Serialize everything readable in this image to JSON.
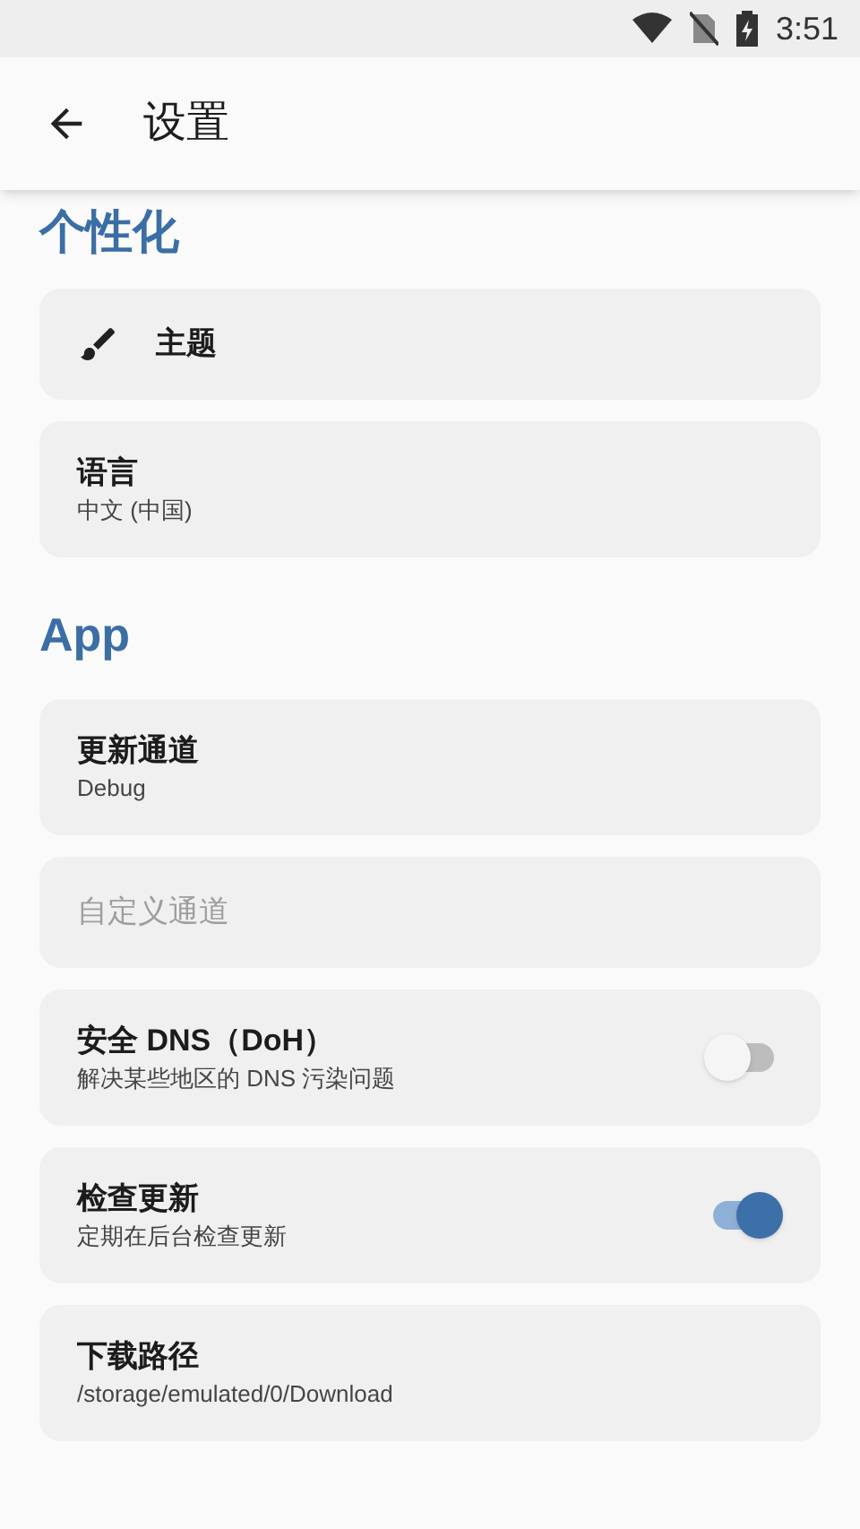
{
  "status_bar": {
    "time": "3:51"
  },
  "app_bar": {
    "title": "设置"
  },
  "sections": [
    {
      "title": "个性化",
      "items": [
        {
          "kind": "icon",
          "title": "主题"
        },
        {
          "kind": "text",
          "title": "语言",
          "subtitle": "中文 (中国)"
        }
      ]
    },
    {
      "title": "App",
      "items": [
        {
          "kind": "text",
          "title": "更新通道",
          "subtitle": "Debug"
        },
        {
          "kind": "text",
          "title": "自定义通道",
          "disabled": true
        },
        {
          "kind": "toggle",
          "title": "安全 DNS（DoH）",
          "subtitle": "解决某些地区的 DNS 污染问题",
          "on": false
        },
        {
          "kind": "toggle",
          "title": "检查更新",
          "subtitle": "定期在后台检查更新",
          "on": true
        },
        {
          "kind": "text",
          "title": "下载路径",
          "subtitle": "/storage/emulated/0/Download"
        }
      ]
    }
  ]
}
